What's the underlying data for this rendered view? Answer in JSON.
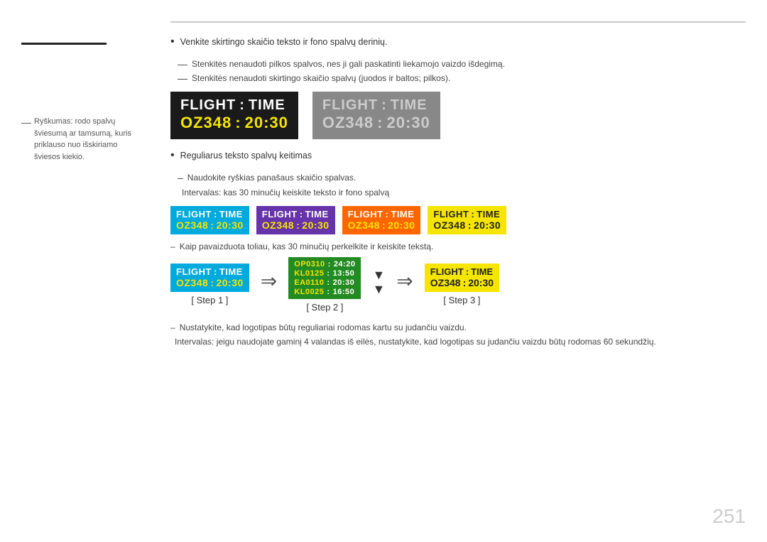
{
  "page": {
    "number": "251"
  },
  "sidebar": {
    "note_label": "Ryškumas: rodo spalvų šviesumą ar tamsumą, kuris priklauso nuo išskiriamo šviesos kiekio."
  },
  "main": {
    "top_bullet_1": "Venkite skirtingo skaičio teksto ir fono spalvų derinių.",
    "dash_1": "Stenkitės nenaudoti pilkos spalvos, nes ji gali paskatinti liekamojo vaizdo išdegimą.",
    "dash_2": "Stenkitės nenaudoti skirtingo skaičio spalvų (juodos ir baltos; pilkos).",
    "board1_line1_a": "FLIGHT",
    "board1_line1_sep": ":",
    "board1_line1_b": "TIME",
    "board1_line2_a": "OZ348",
    "board1_line2_sep": ":",
    "board1_line2_b": "20:30",
    "board2_line1_a": "FLIGHT",
    "board2_line1_sep": ":",
    "board2_line1_b": "TIME",
    "board2_line2_a": "OZ348",
    "board2_line2_sep": ":",
    "board2_line2_b": "20:30",
    "bullet_regular": "Reguliarus teksto spalvų keitimas",
    "dash_regular_1": "Naudokite ryškias panašaus skaičio spalvas.",
    "dash_regular_2": "Intervalas: kas 30 minučių keiskite teksto ir fono spalvą",
    "small_boards": [
      {
        "top_a": "FLIGHT",
        "top_sep": ":",
        "top_b": "TIME",
        "bot_a": "OZ348",
        "bot_sep": ":",
        "bot_b": "20:30",
        "style": "cyan"
      },
      {
        "top_a": "FLIGHT",
        "top_sep": ":",
        "top_b": "TIME",
        "bot_a": "OZ348",
        "bot_sep": ":",
        "bot_b": "20:30",
        "style": "purple"
      },
      {
        "top_a": "FLIGHT",
        "top_sep": ":",
        "top_b": "TIME",
        "bot_a": "OZ348",
        "bot_sep": ":",
        "bot_b": "20:30",
        "style": "orange"
      },
      {
        "top_a": "FLIGHT",
        "top_sep": ":",
        "top_b": "TIME",
        "bot_a": "OZ348",
        "bot_sep": ":",
        "bot_b": "20:30",
        "style": "yellow"
      }
    ],
    "dash_scroll": "Kaip pavaizduota toliau, kas 30 minučių perkelkite ir keiskite tekstą.",
    "step1_label": "[ Step 1 ]",
    "step2_label": "[ Step 2 ]",
    "step3_label": "[ Step 3 ]",
    "step1_board_top_a": "FLIGHT",
    "step1_board_top_sep": ":",
    "step1_board_top_b": "TIME",
    "step1_board_bot_a": "OZ348",
    "step1_board_bot_sep": ":",
    "step1_board_bot_b": "20:30",
    "step2_flights": [
      {
        "flight": "OP0310",
        "sep": ":",
        "time": "24:20"
      },
      {
        "flight": "KL0125",
        "sep": ":",
        "time": "13:50"
      },
      {
        "flight": "EA0110",
        "sep": ":",
        "time": "20:30"
      },
      {
        "flight": "KL0025",
        "sep": ":",
        "time": "16:50"
      }
    ],
    "step3_board_top_a": "FLIGHT",
    "step3_board_top_sep": ":",
    "step3_board_top_b": "TIME",
    "step3_board_bot_a": "OZ348",
    "step3_board_bot_sep": ":",
    "step3_board_bot_b": "20:30",
    "note_dash_1": "Nustatykite, kad logotipas būtų reguliariai rodomas kartu su judančiu vaizdu.",
    "note_dash_2": "Intervalas: jeigu naudojate gaminį 4 valandas iš eilės, nustatykite, kad logotipas su judančiu vaizdu būtų rodomas 60 sekundžių."
  }
}
